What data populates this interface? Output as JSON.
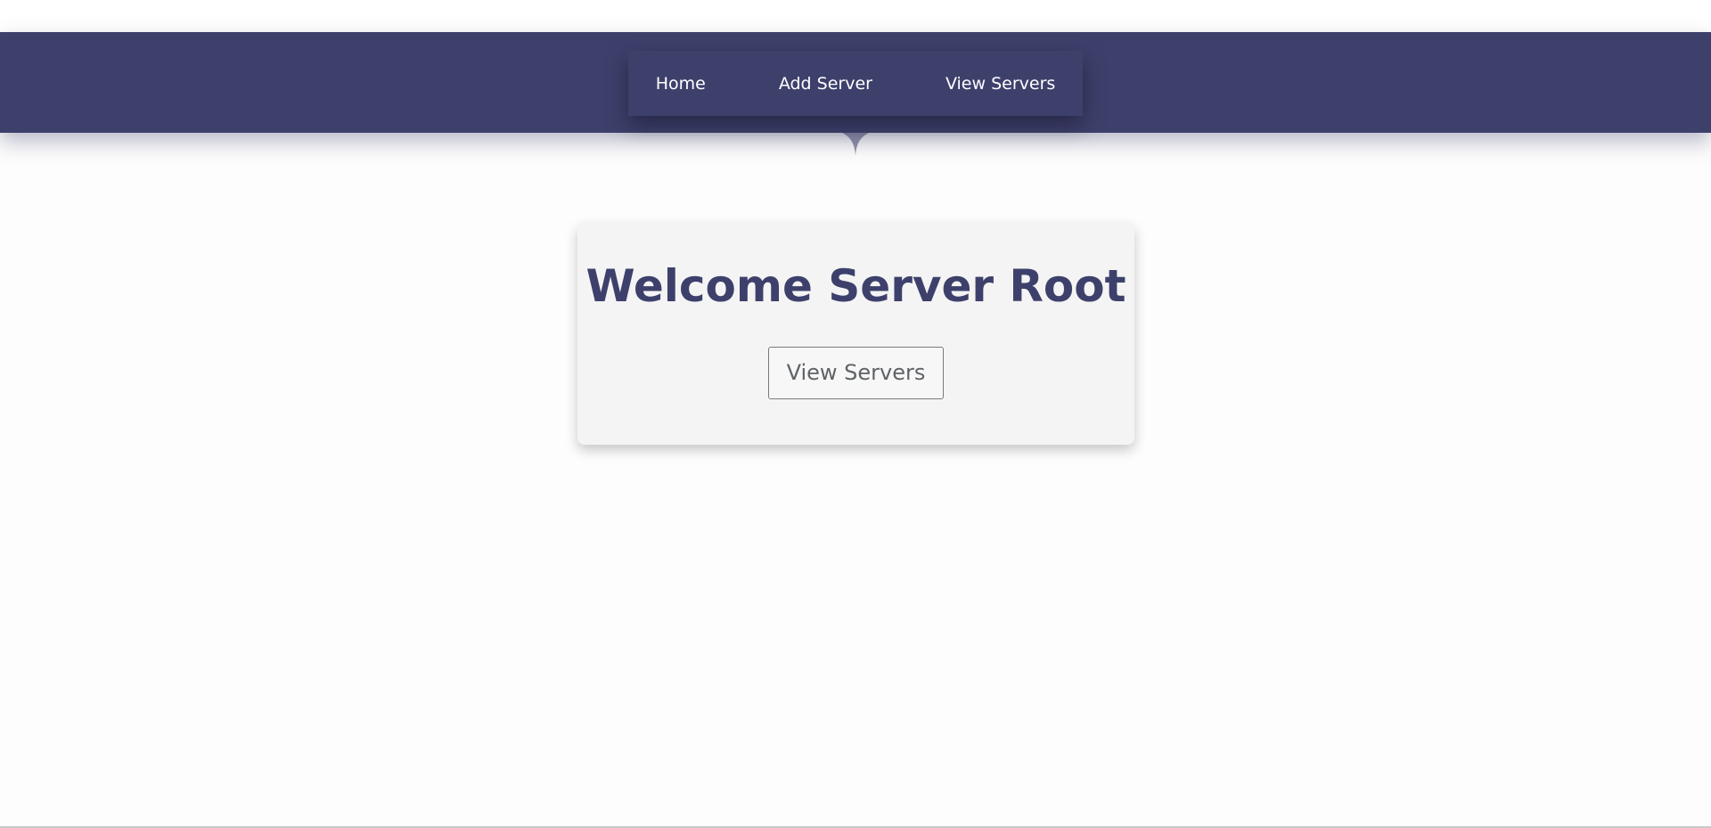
{
  "nav": {
    "items": [
      {
        "label": "Home"
      },
      {
        "label": "Add Server"
      },
      {
        "label": "View Servers"
      }
    ]
  },
  "main": {
    "title": "Welcome Server Root",
    "button_label": "View Servers"
  },
  "colors": {
    "brand": "#3e406c",
    "card_background": "#f4f4f4",
    "page_background": "#fdfdfd"
  }
}
